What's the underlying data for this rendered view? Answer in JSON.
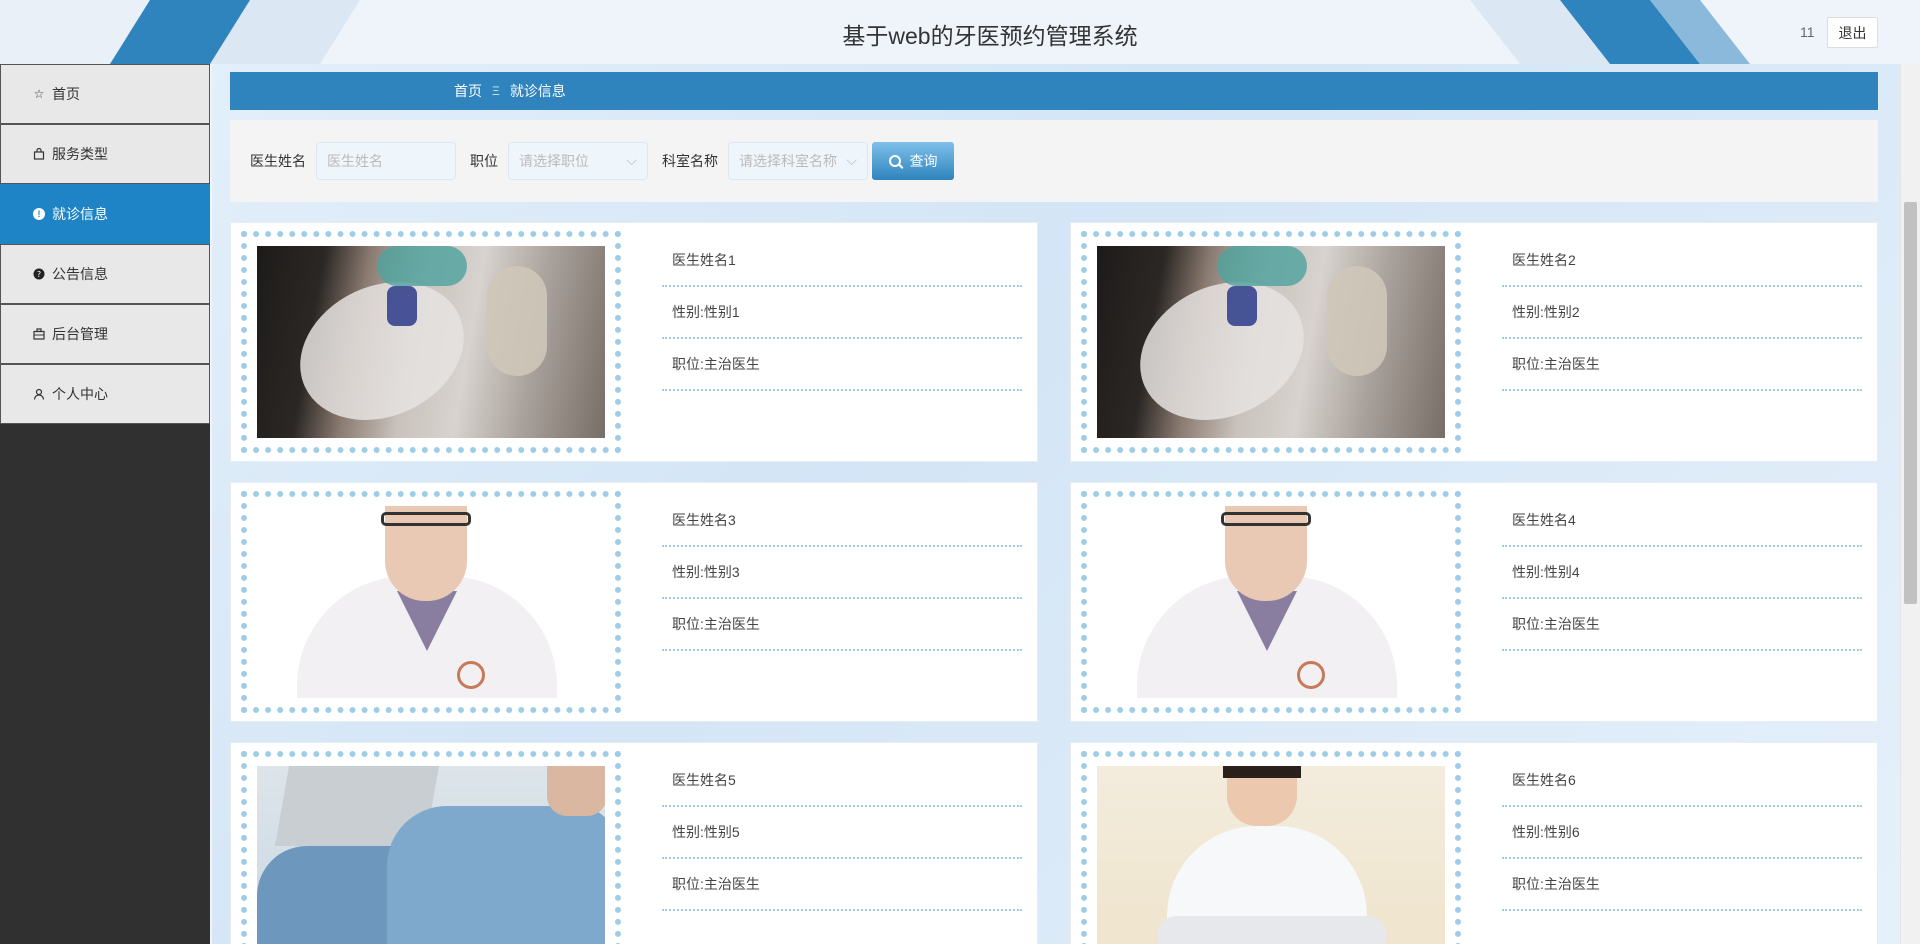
{
  "header": {
    "title": "基于web的牙医预约管理系统",
    "user_name": "11",
    "logout_label": "退出"
  },
  "sidebar": {
    "items": [
      {
        "label": "首页",
        "icon": "star-icon",
        "active": false
      },
      {
        "label": "服务类型",
        "icon": "bag-icon",
        "active": false
      },
      {
        "label": "就诊信息",
        "icon": "info-circle-icon",
        "active": true
      },
      {
        "label": "公告信息",
        "icon": "question-circle-icon",
        "active": false
      },
      {
        "label": "后台管理",
        "icon": "briefcase-icon",
        "active": false
      },
      {
        "label": "个人中心",
        "icon": "user-icon",
        "active": false
      }
    ]
  },
  "breadcrumb": {
    "home": "首页",
    "separator": "Ξ",
    "current": "就诊信息"
  },
  "search": {
    "doctor_name_label": "医生姓名",
    "doctor_name_placeholder": "医生姓名",
    "position_label": "职位",
    "position_placeholder": "请选择职位",
    "department_label": "科室名称",
    "department_placeholder": "请选择科室名称",
    "button_label": "查询"
  },
  "doctors": [
    {
      "name": "医生姓名1",
      "gender": "性别:性别1",
      "position": "职位:主治医生",
      "photo": "surgery"
    },
    {
      "name": "医生姓名2",
      "gender": "性别:性别2",
      "position": "职位:主治医生",
      "photo": "surgery"
    },
    {
      "name": "医生姓名3",
      "gender": "性别:性别3",
      "position": "职位:主治医生",
      "photo": "doctor"
    },
    {
      "name": "医生姓名4",
      "gender": "性别:性别4",
      "position": "职位:主治医生",
      "photo": "doctor"
    },
    {
      "name": "医生姓名5",
      "gender": "性别:性别5",
      "position": "职位:主治医生",
      "photo": "medic"
    },
    {
      "name": "医生姓名6",
      "gender": "性别:性别6",
      "position": "职位:主治医生",
      "photo": "female"
    }
  ],
  "colors": {
    "primary": "#2f84bd",
    "active_menu": "#1e84c6",
    "dotted_border": "#9fcde6"
  }
}
